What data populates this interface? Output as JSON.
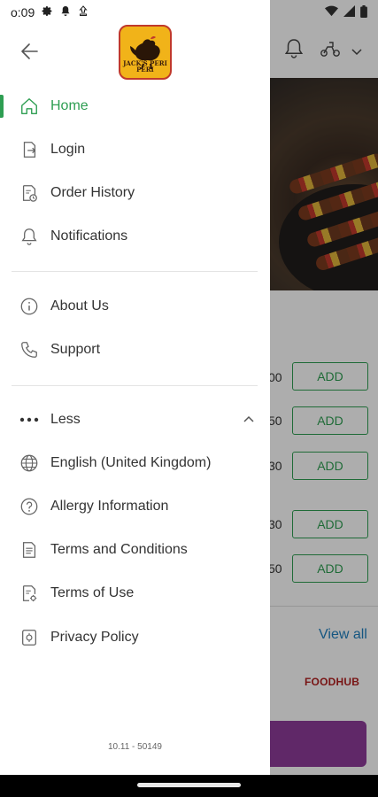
{
  "status_bar": {
    "time": "o:09",
    "left_icons": [
      "gear-icon",
      "notification-bell-icon",
      "download-icon"
    ],
    "right_icons": [
      "wifi-icon",
      "cell-signal-icon",
      "battery-icon"
    ]
  },
  "drawer": {
    "logo_text": "JACK'S PERI PERI",
    "menu_primary": [
      {
        "label": "Home",
        "icon": "home-icon",
        "active": true
      },
      {
        "label": "Login",
        "icon": "login-icon",
        "active": false
      },
      {
        "label": "Order History",
        "icon": "order-history-icon",
        "active": false
      },
      {
        "label": "Notifications",
        "icon": "bell-icon",
        "active": false
      }
    ],
    "menu_secondary": [
      {
        "label": "About Us",
        "icon": "info-icon"
      },
      {
        "label": "Support",
        "icon": "phone-icon"
      }
    ],
    "less_label": "Less",
    "menu_more": [
      {
        "label": "English (United Kingdom)",
        "icon": "globe-icon"
      },
      {
        "label": "Allergy Information",
        "icon": "question-icon"
      },
      {
        "label": "Terms and Conditions",
        "icon": "document-icon"
      },
      {
        "label": "Terms of Use",
        "icon": "document-settings-icon"
      },
      {
        "label": "Privacy Policy",
        "icon": "privacy-icon"
      }
    ],
    "version": "10.11 - 50149"
  },
  "background": {
    "add_label": "ADD",
    "price_fragments": [
      "00",
      "50",
      "30",
      "30",
      "50"
    ],
    "view_all": "View all",
    "brand": "FOODHUB"
  },
  "colors": {
    "accent_green": "#2e9e52",
    "link_blue": "#1f7fbf",
    "brand_purple": "#8e3c9a"
  }
}
